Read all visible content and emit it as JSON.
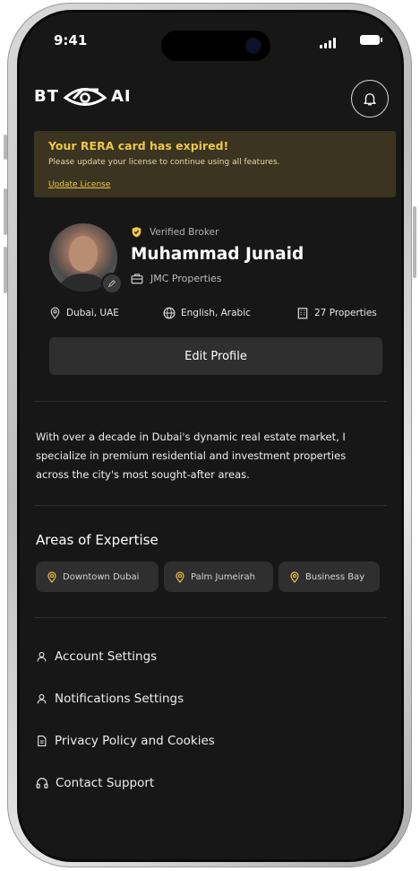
{
  "status_bar": {
    "time": "9:41"
  },
  "header": {
    "logo_left": "BT",
    "logo_right": "AI"
  },
  "alert": {
    "title": "Your RERA card has expired!",
    "message": "Please update your license to continue using all features.",
    "link": "Update License"
  },
  "profile": {
    "badge": "Verified Broker",
    "name": "Muhammad Junaid",
    "company": "JMC Properties",
    "location": "Dubai, UAE",
    "languages": "English, Arabic",
    "properties": "27 Properties",
    "edit_button": "Edit Profile"
  },
  "bio": "With over a decade in Dubai's dynamic real estate market, I specialize in premium residential and investment properties across the city's most sought-after areas.",
  "expertise": {
    "title": "Areas of Expertise",
    "areas": [
      "Downtown Dubai",
      "Palm Jumeirah",
      "Business Bay"
    ]
  },
  "menu": {
    "items": [
      "Account Settings",
      "Notifications Settings",
      "Privacy Policy and Cookies",
      "Contact Support"
    ]
  },
  "colors": {
    "background": "#171717",
    "accent_gold": "#f0c64a",
    "alert_background": "#3a3420",
    "chip_background": "#2f2f2f"
  }
}
